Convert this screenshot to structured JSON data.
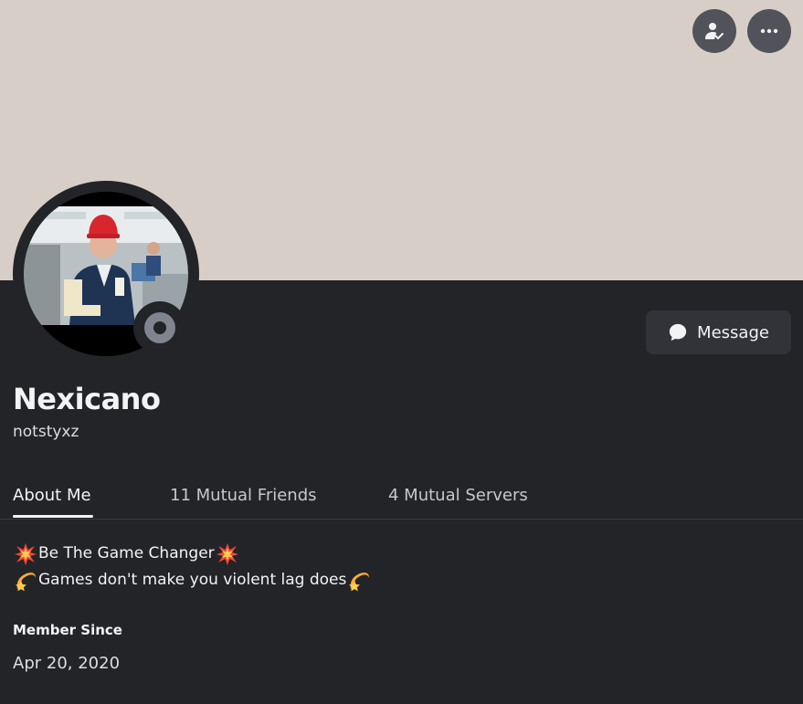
{
  "profile": {
    "display_name": "Nexicano",
    "username": "notstyxz",
    "status": "offline"
  },
  "header": {
    "friend_button_icon": "user-check-icon",
    "more_button_icon": "more-dots-icon"
  },
  "actions": {
    "message_label": "Message",
    "message_icon": "chat-bubble-icon"
  },
  "tabs": [
    {
      "label": "About Me",
      "active": true
    },
    {
      "label": "11 Mutual Friends",
      "active": false
    },
    {
      "label": "4 Mutual Servers",
      "active": false
    }
  ],
  "about": {
    "bio_lines": [
      {
        "prefix_emoji": "collision-emoji",
        "text": "Be The Game Changer",
        "suffix_emoji": "collision-emoji"
      },
      {
        "prefix_emoji": "dizzy-emoji",
        "text": "Games don't make you violent lag does",
        "suffix_emoji": "dizzy-emoji"
      }
    ],
    "member_since_heading": "Member Since",
    "member_since_date": "Apr 20, 2020"
  },
  "colors": {
    "banner": "#d8cec8",
    "background": "#232428",
    "button": "#313338",
    "status_offline": "#80848e"
  }
}
